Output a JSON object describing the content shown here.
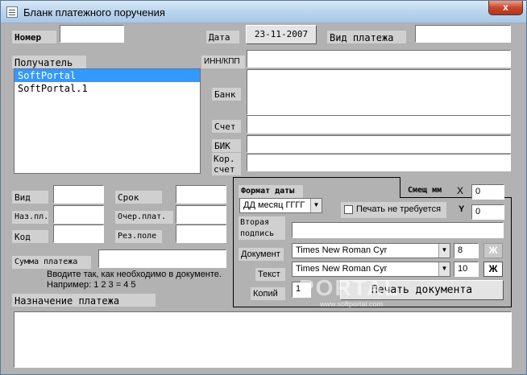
{
  "window": {
    "title": "Бланк платежного поручения",
    "close_glyph": "x"
  },
  "header": {
    "number_label": "Номер",
    "number_value": "",
    "date_label": "Дата",
    "date_value": "23-11-2007",
    "payment_type_label": "Вид платежа",
    "payment_type_value": ""
  },
  "recipient": {
    "label": "Получатель",
    "items": [
      {
        "label": "SoftPortal"
      },
      {
        "label": "SoftPortal.1"
      }
    ],
    "inn_label": "ИНН/КПП",
    "inn_value": "",
    "bank_label": "Банк",
    "bank_value": "",
    "account_label": "Счет",
    "account_value": "",
    "bik_label": "БИК",
    "bik_value": "",
    "kor_label_1": "Кор.",
    "kor_label_2": "счет",
    "kor_value": ""
  },
  "fields": {
    "vid_label": "Вид",
    "vid_value": "",
    "naz_label": "Наз.пл.",
    "naz_value": "",
    "kod_label": "Код",
    "kod_value": "",
    "srok_label": "Срок",
    "srok_value": "",
    "ocher_label": "Очер.плат.",
    "ocher_value": "",
    "rez_label": "Рез.поле",
    "rez_value": ""
  },
  "amount": {
    "label": "Сумма платежа",
    "value": "",
    "hint_1": "Вводите так, как необходимо в документе.",
    "hint_2": "Например: 1 2 3 = 4 5"
  },
  "purpose": {
    "label": "Назначение платежа",
    "value": ""
  },
  "settings": {
    "date_format_label": "Формат даты",
    "date_format_value": "ДД месяц ГГГГ",
    "offset_label": "Смещ мм",
    "x_label": "X",
    "x_value": "0",
    "y_label": "Y",
    "y_value": "0",
    "no_print_label": "Печать не требуется",
    "second_sign_label_1": "Вторая",
    "second_sign_label_2": "подпись",
    "second_sign_value": "",
    "document_label": "Документ",
    "document_font": "Times New Roman Cyr",
    "document_size": "8",
    "document_bold": "Ж",
    "text_label": "Текст",
    "text_font": "Times New Roman Cyr",
    "text_size": "10",
    "text_bold": "Ж",
    "copies_label": "Копий",
    "copies_value": "1",
    "print_button": "Печать документа"
  },
  "watermark": {
    "main": "PORTAL",
    "sub": "www.softportal.com"
  }
}
